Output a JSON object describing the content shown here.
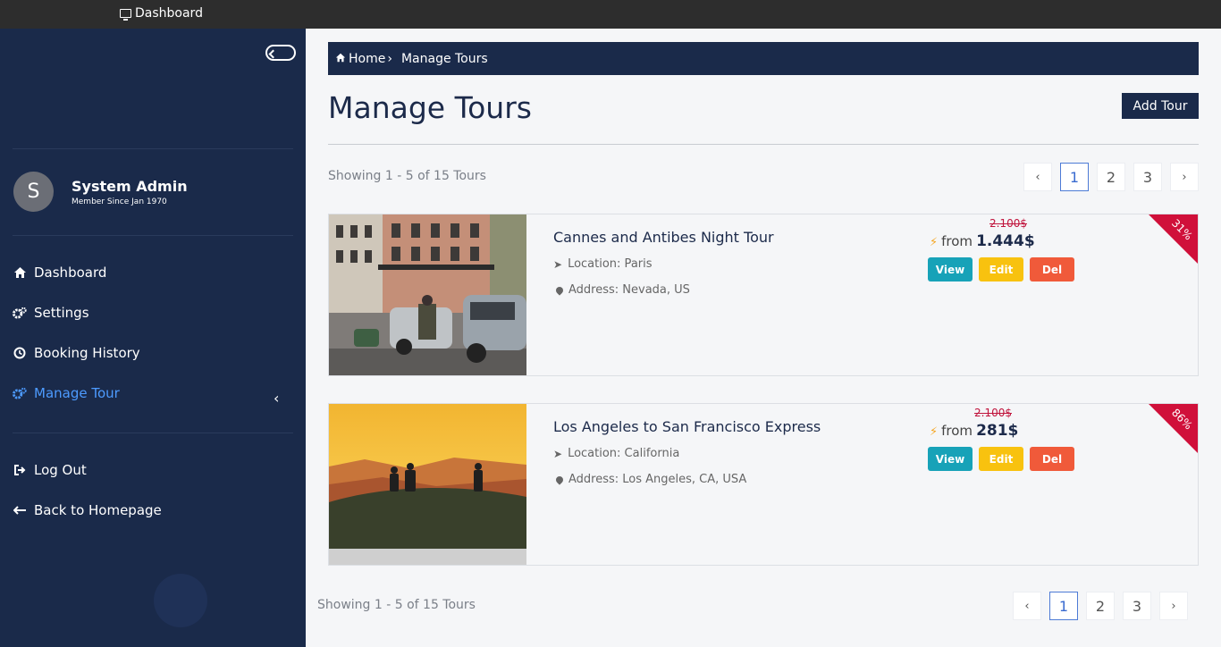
{
  "topbar": {
    "label": "Dashboard"
  },
  "user": {
    "initial": "S",
    "name": "System Admin",
    "since": "Member Since Jan 1970"
  },
  "nav": {
    "dashboard": "Dashboard",
    "settings": "Settings",
    "booking_history": "Booking History",
    "manage_tour": "Manage Tour",
    "logout": "Log Out",
    "back_home": "Back to Homepage"
  },
  "breadcrumb": {
    "home": "Home",
    "current": "Manage Tours"
  },
  "page": {
    "title": "Manage Tours",
    "add_button": "Add Tour",
    "showing": "Showing 1 - 5 of 15 Tours"
  },
  "pagination": {
    "prev": "‹",
    "pages": [
      "1",
      "2",
      "3"
    ],
    "next": "›",
    "current": "1"
  },
  "tours": [
    {
      "name": "Cannes and Antibes Night Tour",
      "location": "Location: Paris",
      "address": "Address: Nevada, US",
      "old_price": "2.100$",
      "from": "from",
      "price": "1.444$",
      "discount": "31%"
    },
    {
      "name": "Los Angeles to San Francisco Express",
      "location": "Location: California",
      "address": "Address: Los Angeles, CA, USA",
      "old_price": "2.100$",
      "from": "from",
      "price": "281$",
      "discount": "86%"
    }
  ],
  "actions": {
    "view": "View",
    "edit": "Edit",
    "del": "Del"
  },
  "colors": {
    "navy": "#1a2a4a",
    "active_nav": "#4d9bff",
    "view": "#17a2b8",
    "edit": "#f8c20f",
    "del": "#f05a3a",
    "ribbon": "#d0103a"
  }
}
